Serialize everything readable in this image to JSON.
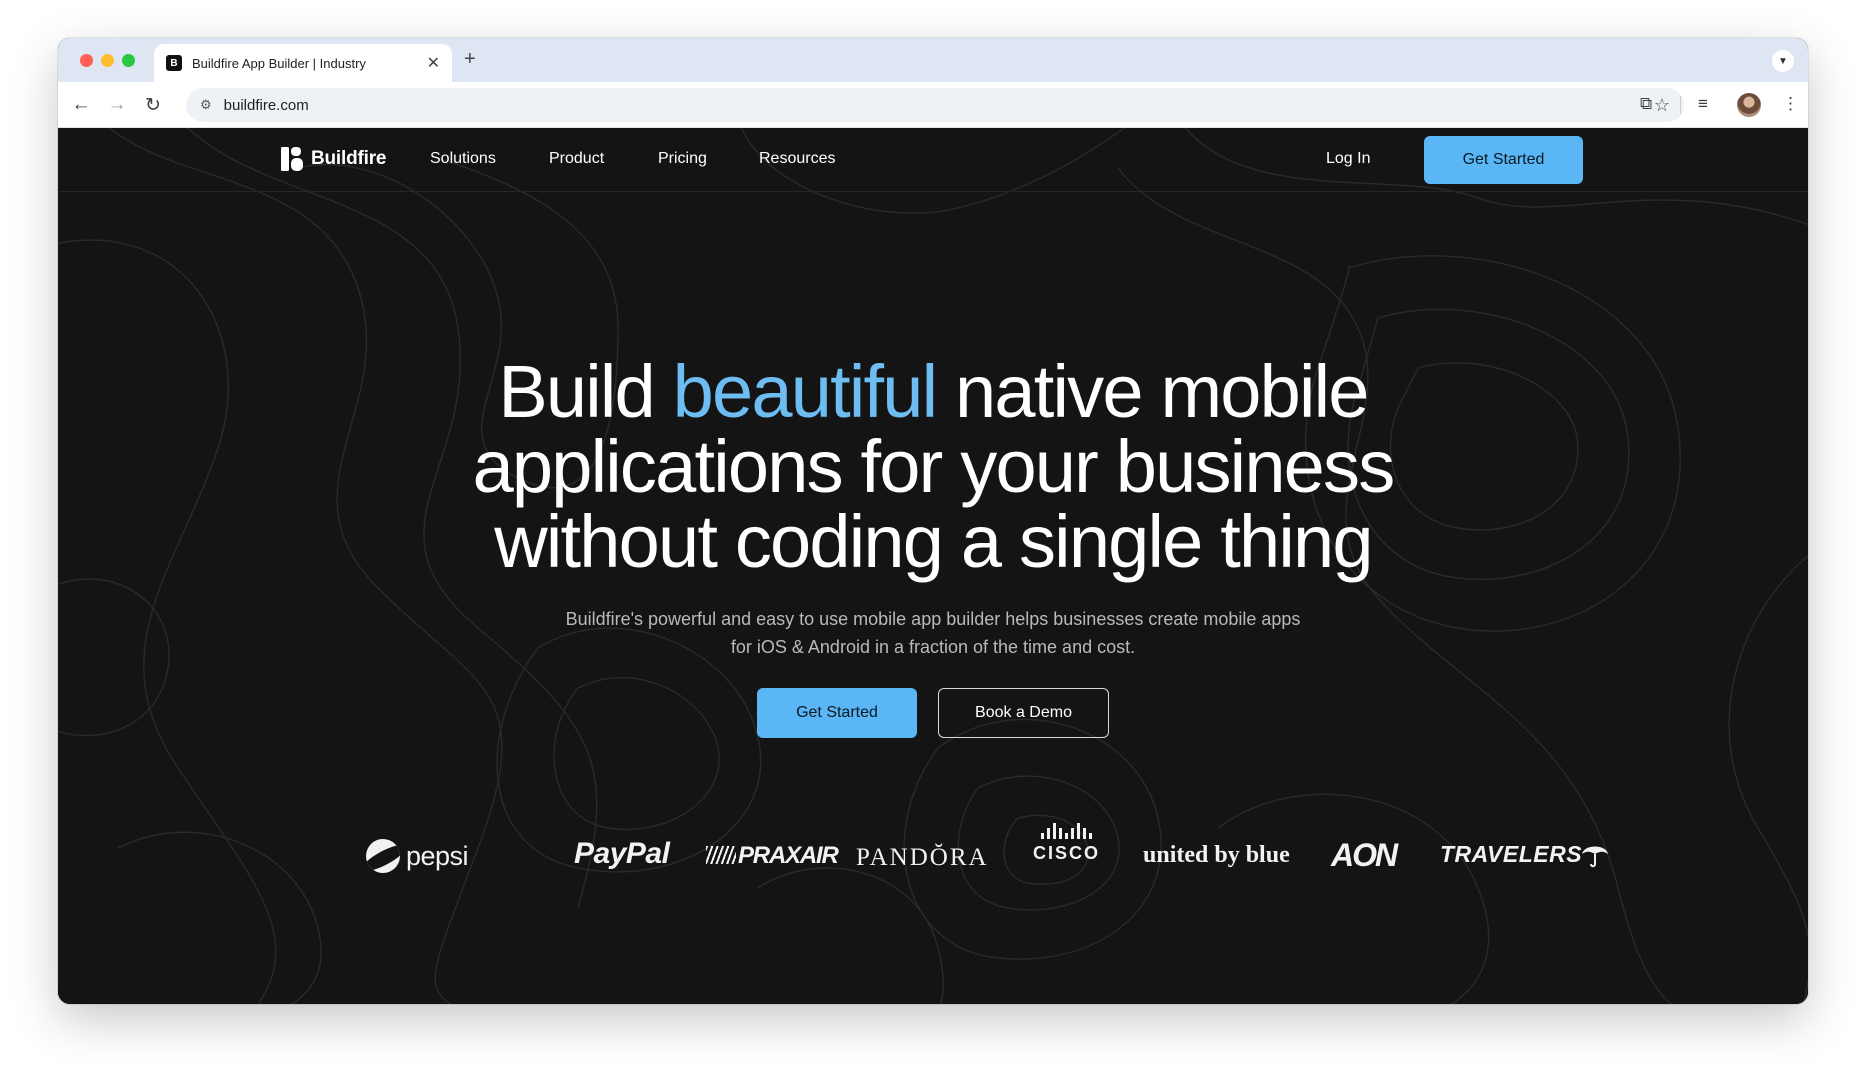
{
  "browser": {
    "tab_title": "Buildfire App Builder | Industry",
    "tab_favicon_letter": "B",
    "url": "buildfire.com"
  },
  "nav": {
    "brand": "Buildfire",
    "links": [
      "Solutions",
      "Product",
      "Pricing",
      "Resources"
    ],
    "login": "Log In",
    "cta": "Get Started"
  },
  "hero": {
    "title_before": "Build",
    "title_accent": "beautiful",
    "title_after_line1": "native mobile",
    "title_line2": "applications for your business",
    "title_line3": "without coding a single thing",
    "subtitle_line1": "Buildfire's powerful and easy to use mobile app builder helps businesses create mobile apps",
    "subtitle_line2": "for iOS & Android in a fraction of the time and cost.",
    "primary_cta": "Get Started",
    "secondary_cta": "Book a Demo"
  },
  "logos": {
    "pepsi": "pepsi",
    "paypal": "PayPal",
    "praxair": "PRAXAIR",
    "pandora": "PANDŎRA",
    "cisco": "CISCO",
    "united_by_blue": "united by blue",
    "aon": "AON",
    "travelers": "TRAVELERS"
  },
  "colors": {
    "accent": "#5ab6f5",
    "accent_text": "#6dbdf2",
    "background": "#141414"
  }
}
